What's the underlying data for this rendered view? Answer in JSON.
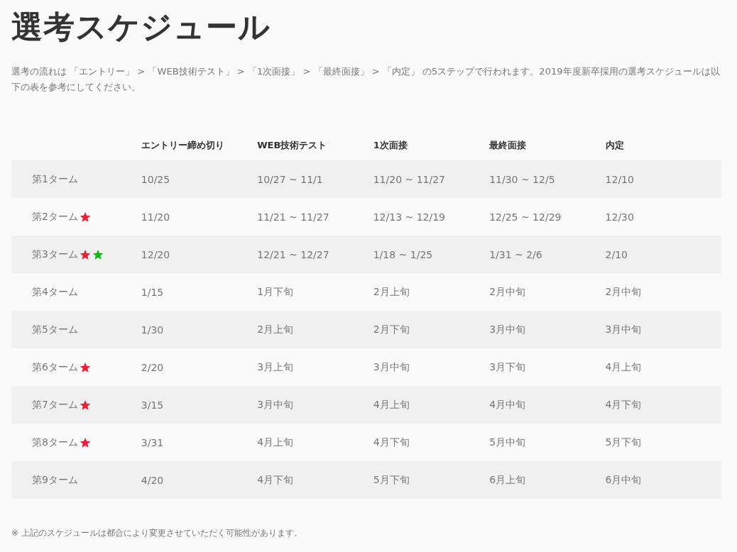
{
  "title": "選考スケジュール",
  "intro": "選考の流れは 「エントリー」 > 「WEB技術テスト」 > 「1次面接」 > 「最終面接」 > 「内定」 の5ステップで行われます。2019年度新卒採用の選考スケジュールは以下の表を参考にしてください。",
  "table": {
    "columns": [
      "エントリー締め切り",
      "WEB技術テスト",
      "1次面接",
      "最終面接",
      "内定"
    ],
    "rows": [
      {
        "term": "第1ターム",
        "markers": [],
        "cells": [
          "10/25",
          "10/27 ~ 11/1",
          "11/20 ~ 11/27",
          "11/30 ~ 12/5",
          "12/10"
        ]
      },
      {
        "term": "第2ターム",
        "markers": [
          {
            "color": "#e8203a"
          }
        ],
        "cells": [
          "11/20",
          "11/21 ~ 11/27",
          "12/13 ~ 12/19",
          "12/25 ~ 12/29",
          "12/30"
        ]
      },
      {
        "term": "第3ターム",
        "markers": [
          {
            "color": "#e8203a"
          },
          {
            "color": "#14b814"
          }
        ],
        "cells": [
          "12/20",
          "12/21 ~ 12/27",
          "1/18 ~ 1/25",
          "1/31 ~ 2/6",
          "2/10"
        ]
      },
      {
        "term": "第4ターム",
        "markers": [],
        "cells": [
          "1/15",
          "1月下旬",
          "2月上旬",
          "2月中旬",
          "2月中旬"
        ]
      },
      {
        "term": "第5ターム",
        "markers": [],
        "cells": [
          "1/30",
          "2月上旬",
          "2月下旬",
          "3月中旬",
          "3月中旬"
        ]
      },
      {
        "term": "第6ターム",
        "markers": [
          {
            "color": "#e8203a"
          }
        ],
        "cells": [
          "2/20",
          "3月上旬",
          "3月中旬",
          "3月下旬",
          "4月上旬"
        ]
      },
      {
        "term": "第7ターム",
        "markers": [
          {
            "color": "#e8203a"
          }
        ],
        "cells": [
          "3/15",
          "3月中旬",
          "4月上旬",
          "4月中旬",
          "4月下旬"
        ]
      },
      {
        "term": "第8ターム",
        "markers": [
          {
            "color": "#e8203a"
          }
        ],
        "cells": [
          "3/31",
          "4月上旬",
          "4月下旬",
          "5月中旬",
          "5月下旬"
        ]
      },
      {
        "term": "第9ターム",
        "markers": [],
        "cells": [
          "4/20",
          "4月下旬",
          "5月下旬",
          "6月上旬",
          "6月中旬"
        ]
      }
    ]
  },
  "note": "※ 上記のスケジュールは都合により変更させていただく可能性があります。"
}
